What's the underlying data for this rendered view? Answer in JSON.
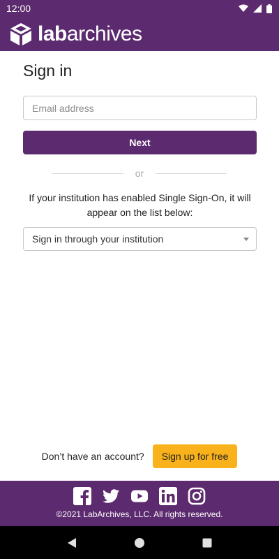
{
  "status_bar": {
    "time": "12:00"
  },
  "header": {
    "brand_bold": "lab",
    "brand_rest": "archives"
  },
  "signin": {
    "title": "Sign in",
    "email_placeholder": "Email address",
    "next_label": "Next",
    "or_label": "or",
    "sso_text": "If your institution has enabled Single Sign-On, it will appear on the list below:",
    "institution_select": "Sign in through your institution"
  },
  "signup": {
    "prompt": "Don’t have an account?",
    "button_label": "Sign up for free"
  },
  "footer": {
    "social_icons": [
      "facebook-icon",
      "twitter-icon",
      "youtube-icon",
      "linkedin-icon",
      "instagram-icon"
    ],
    "copyright": "©2021 LabArchives, LLC. All rights reserved."
  },
  "colors": {
    "brand_purple": "#5c2a6e",
    "accent_yellow": "#f9b21b"
  }
}
